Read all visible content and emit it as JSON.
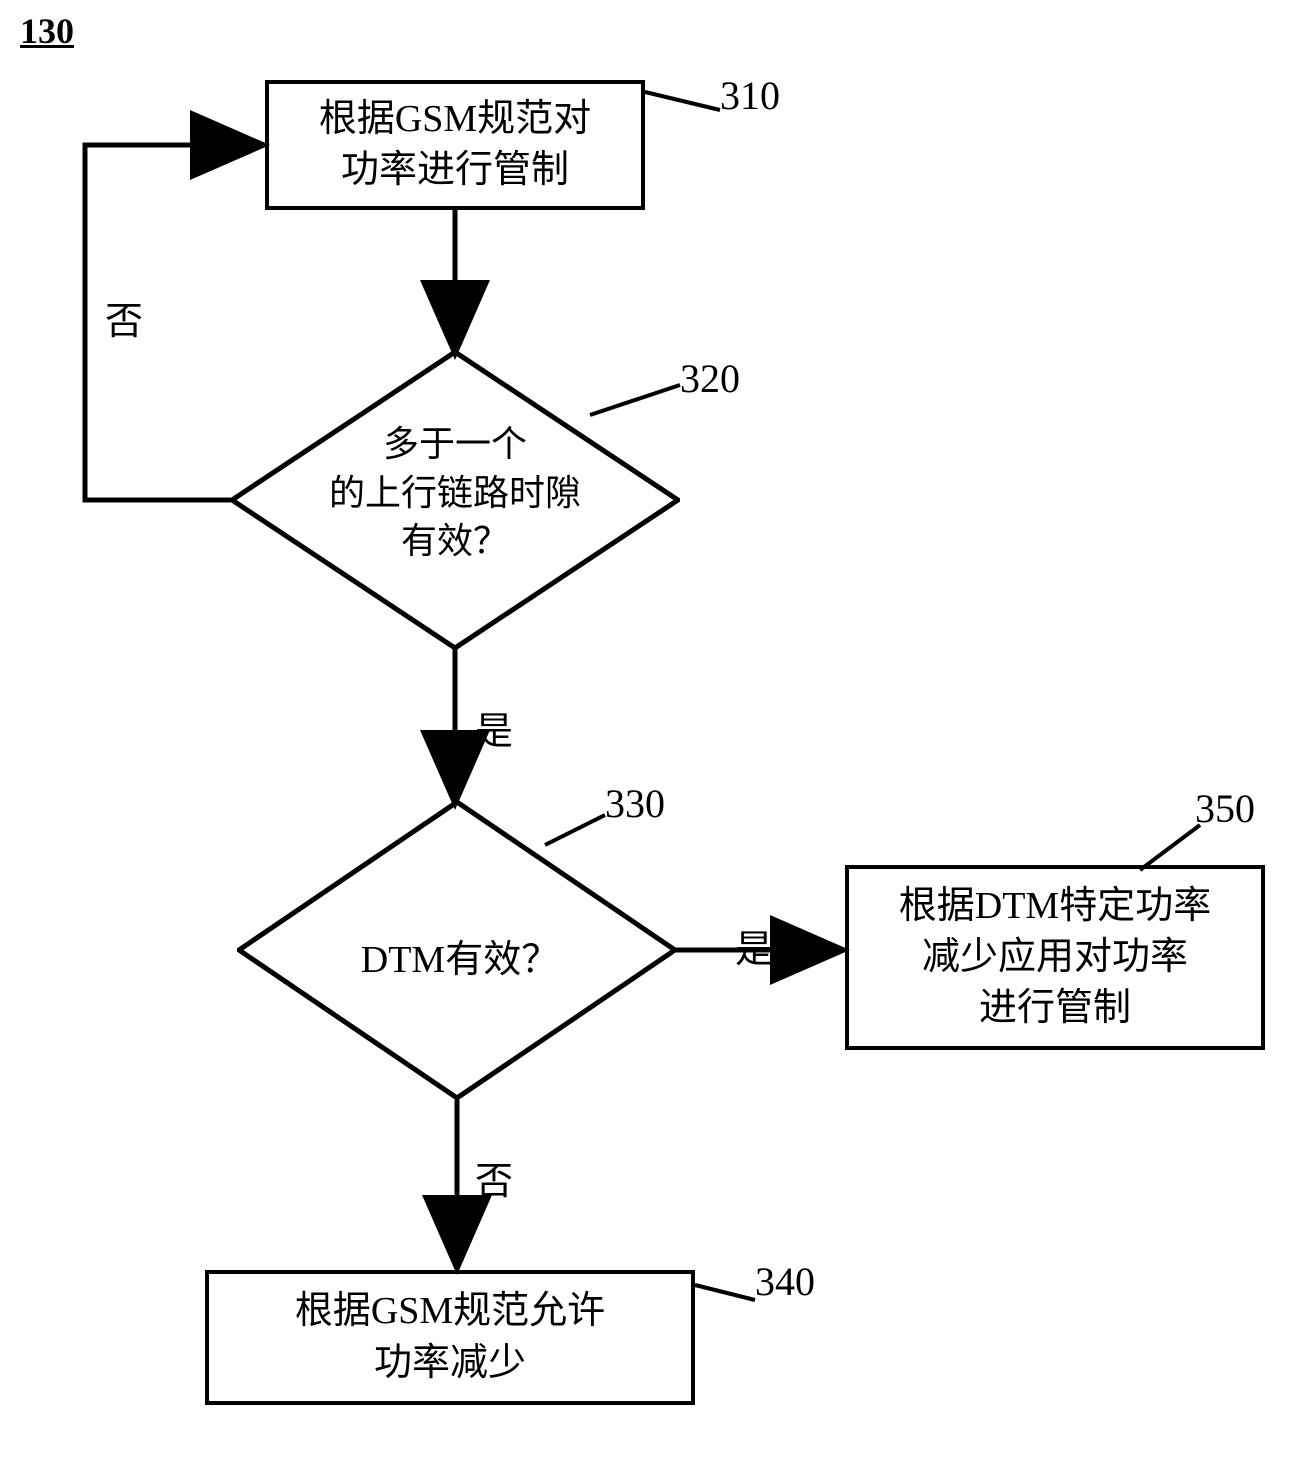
{
  "figure_number": "130",
  "nodes": {
    "n310": {
      "text": "根据GSM规范对\n功率进行管制",
      "ref": "310"
    },
    "n320": {
      "text": "多于一个\n的上行链路时隙\n有效？",
      "ref": "320"
    },
    "n330": {
      "text": "DTM有效？",
      "ref": "330"
    },
    "n340": {
      "text": "根据GSM规范允许\n功率减少",
      "ref": "340"
    },
    "n350": {
      "text": "根据DTM特定功率\n减少应用对功率\n进行管制",
      "ref": "350"
    }
  },
  "edge_labels": {
    "no1": "否",
    "yes1": "是",
    "yes2": "是",
    "no2": "否"
  }
}
